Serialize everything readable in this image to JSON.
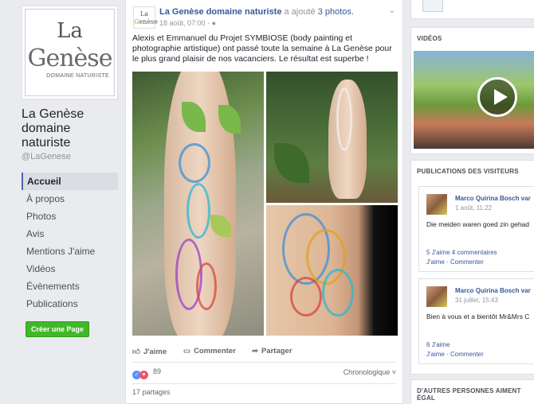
{
  "page": {
    "name": "La Genèse domaine naturiste",
    "handle": "@LaGenese",
    "logo": {
      "word1": "La",
      "word2": "Genèse",
      "tagline": "DOMAINE NATURISTE"
    }
  },
  "nav": {
    "items": [
      "Accueil",
      "À propos",
      "Photos",
      "Avis",
      "Mentions J'aime",
      "Vidéos",
      "Évènements",
      "Publications"
    ],
    "create_page": "Créer une Page"
  },
  "post": {
    "author": "La Genèse domaine naturiste",
    "action_prefix": "a ajouté",
    "action_count": "3 photos.",
    "date": "18 août, 07:00 · ",
    "text": "Alexis et Emmanuel du Projet SYMBIOSE (body painting et photographie artistique) ont passé toute la semaine à La Genèse pour le plus grand plaisir de nos vacanciers. Le résultat est superbe !",
    "actions": {
      "like": "J'aime",
      "comment": "Commenter",
      "share": "Partager"
    },
    "reactions_count": "89",
    "sort_label": "Chronologique",
    "shares": "17 partages"
  },
  "sidebar": {
    "videos_title": "VIDÉOS",
    "visitors_title": "PUBLICATIONS DES VISITEURS",
    "others_title": "D'AUTRES PERSONNES AIMENT ÉGAL",
    "visitor_posts": [
      {
        "name": "Marco Quirina Bosch var",
        "date": "1 août, 11:22",
        "text": "Die meiden waren goed zin gehad",
        "stats": "5 J'aime   4 commentaires",
        "links": "J'aime · Commenter"
      },
      {
        "name": "Marco Quirina Bosch var",
        "date": "31 juillet, 15:43",
        "text": "Bien à vous et a bientôt Mr&Mrs C",
        "stats": "6 J'aime",
        "links": "J'aime · Commenter"
      }
    ]
  },
  "colors": {
    "link": "#365899",
    "accent_green": "#42b72a",
    "logo_green": "#77b52f",
    "background": "#e9ebee"
  }
}
